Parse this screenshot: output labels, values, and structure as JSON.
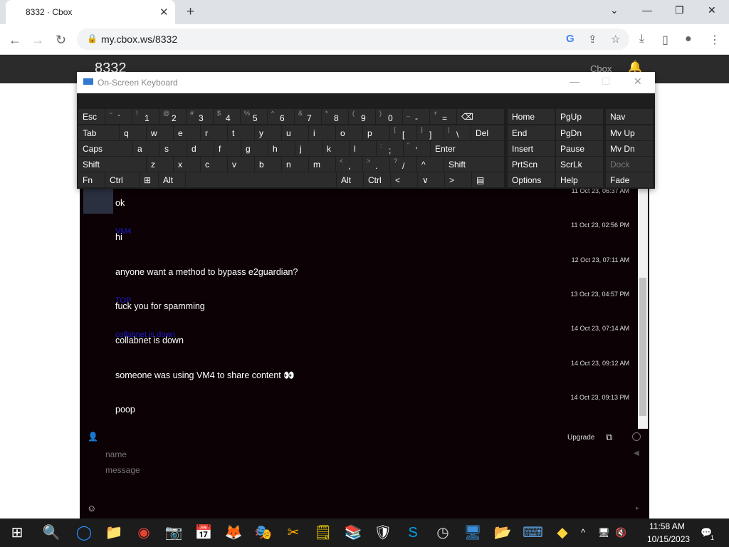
{
  "browser": {
    "tab_title": "8332 · Cbox",
    "close_tab": "✕",
    "new_tab": "+",
    "url": "my.cbox.ws/8332",
    "window": {
      "dropdown": "⌄",
      "minimize": "—",
      "restore": "❐",
      "close": "✕"
    },
    "nav": {
      "back": "←",
      "forward": "→",
      "reload": "↻"
    },
    "icons": {
      "lock": "🔒",
      "google": "G",
      "share": "⇪",
      "star": "☆",
      "download": "⤓",
      "sidepanel": "▯",
      "profile": "●",
      "menu": "⋮"
    }
  },
  "page": {
    "title": "8332",
    "cbox_link": "Cbox",
    "bell_icon": "🔔"
  },
  "chat": {
    "messages": [
      {
        "name": "",
        "text": "ok",
        "time": "11 Oct 23, 06:37 AM"
      },
      {
        "name": "VM4",
        "text": "hi",
        "time": "11 Oct 23, 02:56 PM"
      },
      {
        "name": "",
        "text": "anyone want a method to bypass e2guardian?",
        "time": "12 Oct 23, 07:11 AM"
      },
      {
        "name": "TOP",
        "text": "fuck you for spamming",
        "time": "13 Oct 23, 04:57 PM"
      },
      {
        "name": "collabnet is down",
        "text": "collabnet is down",
        "time": "14 Oct 23, 07:14 AM"
      },
      {
        "name": "",
        "text": "someone was using VM4 to share content 👀",
        "time": "14 Oct 23, 09:12 AM"
      },
      {
        "name": "",
        "text": "poop",
        "time": "14 Oct 23, 09:13 PM"
      }
    ],
    "form": {
      "name_placeholder": "name",
      "message_placeholder": "message",
      "upgrade": "Upgrade",
      "user_icon": "👤",
      "popout_icon": "⧉",
      "send_icon": "◀",
      "smiley_icon": "☺",
      "arrow_icon": "▸"
    }
  },
  "osk": {
    "title": "On-Screen Keyboard",
    "window": {
      "minimize": "—",
      "maximize": "☐",
      "close": "✕"
    },
    "row1": [
      {
        "main": "Esc"
      },
      {
        "sub": "~",
        "main": "`"
      },
      {
        "sub": "!",
        "main": "1"
      },
      {
        "sub": "@",
        "main": "2"
      },
      {
        "sub": "#",
        "main": "3"
      },
      {
        "sub": "$",
        "main": "4"
      },
      {
        "sub": "%",
        "main": "5"
      },
      {
        "sub": "^",
        "main": "6"
      },
      {
        "sub": "&",
        "main": "7"
      },
      {
        "sub": "*",
        "main": "8"
      },
      {
        "sub": "(",
        "main": "9"
      },
      {
        "sub": ")",
        "main": "0"
      },
      {
        "sub": "_",
        "main": "-"
      },
      {
        "sub": "+",
        "main": "="
      },
      {
        "main": "⌫"
      }
    ],
    "row2": [
      {
        "main": "Tab"
      },
      {
        "main": "q"
      },
      {
        "main": "w"
      },
      {
        "main": "e"
      },
      {
        "main": "r"
      },
      {
        "main": "t"
      },
      {
        "main": "y"
      },
      {
        "main": "u"
      },
      {
        "main": "i"
      },
      {
        "main": "o"
      },
      {
        "main": "p"
      },
      {
        "sub": "{",
        "main": "["
      },
      {
        "sub": "}",
        "main": "]"
      },
      {
        "sub": "|",
        "main": "\\"
      },
      {
        "main": "Del"
      }
    ],
    "row3": [
      {
        "main": "Caps"
      },
      {
        "main": "a"
      },
      {
        "main": "s"
      },
      {
        "main": "d"
      },
      {
        "main": "f"
      },
      {
        "main": "g"
      },
      {
        "main": "h"
      },
      {
        "main": "j"
      },
      {
        "main": "k"
      },
      {
        "main": "l"
      },
      {
        "sub": ":",
        "main": ";"
      },
      {
        "sub": "\"",
        "main": "'"
      },
      {
        "main": "Enter"
      }
    ],
    "row4": [
      {
        "main": "Shift"
      },
      {
        "main": "z"
      },
      {
        "main": "x"
      },
      {
        "main": "c"
      },
      {
        "main": "v"
      },
      {
        "main": "b"
      },
      {
        "main": "n"
      },
      {
        "main": "m"
      },
      {
        "sub": "<",
        "main": ","
      },
      {
        "sub": ">",
        "main": "."
      },
      {
        "sub": "?",
        "main": "/"
      },
      {
        "main": "^"
      },
      {
        "main": "Shift"
      }
    ],
    "row5": [
      {
        "main": "Fn"
      },
      {
        "main": "Ctrl"
      },
      {
        "main": "⊞"
      },
      {
        "main": "Alt"
      },
      {
        "main": ""
      },
      {
        "main": "Alt"
      },
      {
        "main": "Ctrl"
      },
      {
        "main": "<"
      },
      {
        "main": "∨"
      },
      {
        "main": ">"
      },
      {
        "main": "▤"
      }
    ],
    "nav_cols": [
      [
        "Home",
        "End",
        "Insert",
        "PrtScn",
        "Options"
      ],
      [
        "PgUp",
        "PgDn",
        "Pause",
        "ScrLk",
        "Help"
      ],
      [
        "Nav",
        "Mv Up",
        "Mv Dn",
        "Dock",
        "Fade"
      ]
    ]
  },
  "taskbar": {
    "apps": [
      "⊞",
      "🔍",
      "◯",
      "📁",
      "◉",
      "📷",
      "📅",
      "🦊",
      "🎭",
      "✂",
      "🗒",
      "📚",
      "🛡",
      "S",
      "◷",
      "🖥",
      "📂",
      "⌨",
      "◆"
    ],
    "tray": {
      "chevron": "^",
      "network": "🖥",
      "volume": "🔇",
      "notifications": "💬",
      "badge": "1"
    },
    "time": "11:58 AM",
    "date": "10/15/2023"
  }
}
